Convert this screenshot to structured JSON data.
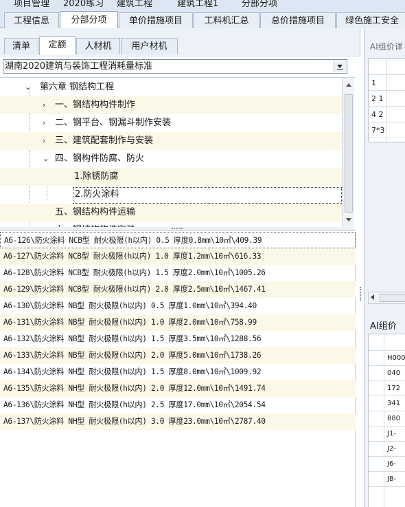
{
  "breadcrumb": [
    "项目管理",
    "2020练习",
    "建筑工程",
    "建筑工程1",
    "分部分项"
  ],
  "main_tabs": [
    "工程信息",
    "分部分项",
    "单价措施项目",
    "工料机汇总",
    "总价措施项目",
    "绿色施工安全"
  ],
  "sub_tabs": [
    "清单",
    "定额",
    "人材机",
    "用户材机"
  ],
  "library_select": "湖南2020建筑与装饰工程消耗量标准",
  "tree": [
    {
      "label": "第六章 钢结构工程",
      "state": "expanded"
    },
    {
      "label": "一、钢结构构件制作",
      "state": "collapsed"
    },
    {
      "label": "二、钢平台、钢漏斗制作安装",
      "state": "collapsed"
    },
    {
      "label": "三、建筑配套制作与安装",
      "state": "collapsed"
    },
    {
      "label": "四、钢构件防腐、防火",
      "state": "expanded"
    },
    {
      "label": "1.除锈防腐",
      "state": "leaf"
    },
    {
      "label": "2.防火涂料",
      "state": "leaf-selected"
    },
    {
      "label": "五、钢结构构件运输",
      "state": "leaf"
    },
    {
      "label": "六、钢结构构件安装",
      "state": "partial"
    }
  ],
  "items": [
    "A6-126\\防火涂料 NCB型 耐火极限(h以内) 0.5 厚度0.8mm\\10㎡\\409.39",
    "A6-127\\防火涂料 NCB型 耐火极限(h以内) 1.0 厚度1.2mm\\10㎡\\616.33",
    "A6-128\\防火涂料 NCB型 耐火极限(h以内) 1.5 厚度2.0mm\\10㎡\\1005.26",
    "A6-129\\防火涂料 NCB型 耐火极限(h以内) 2.0 厚度2.5mm\\10㎡\\1467.41",
    "A6-130\\防火涂料 NB型 耐火极限(h以内) 0.5 厚度1.0mm\\10㎡\\394.40",
    "A6-131\\防火涂料 NB型 耐火极限(h以内) 1.0 厚度2.0mm\\10㎡\\758.99",
    "A6-132\\防火涂料 NB型 耐火极限(h以内) 1.5 厚度3.5mm\\10㎡\\1288.56",
    "A6-133\\防火涂料 NB型 耐火极限(h以内) 2.0 厚度5.0mm\\10㎡\\1738.26",
    "A6-134\\防火涂料 NH型 耐火极限(h以内) 1.5 厚度8.0mm\\10㎡\\1009.92",
    "A6-135\\防火涂料 NH型 耐火极限(h以内) 2.0 厚度12.0mm\\10㎡\\1491.74",
    "A6-136\\防火涂料 NH型 耐火极限(h以内) 2.5 厚度17.0mm\\10㎡\\2054.54",
    "A6-137\\防火涂料 NH型 耐火极限(h以内) 3.0 厚度23.0mm\\10㎡\\2787.40"
  ],
  "right_panel": {
    "header_top": "AI组价详",
    "rows_top": [
      "1",
      "2 1",
      "4 2",
      "7*3"
    ],
    "header_bottom": "AI组价",
    "rows_bottom": [
      "H000",
      "040",
      "172",
      "341",
      "880",
      "J1-",
      "J2-",
      "J6-",
      "J8-"
    ]
  }
}
